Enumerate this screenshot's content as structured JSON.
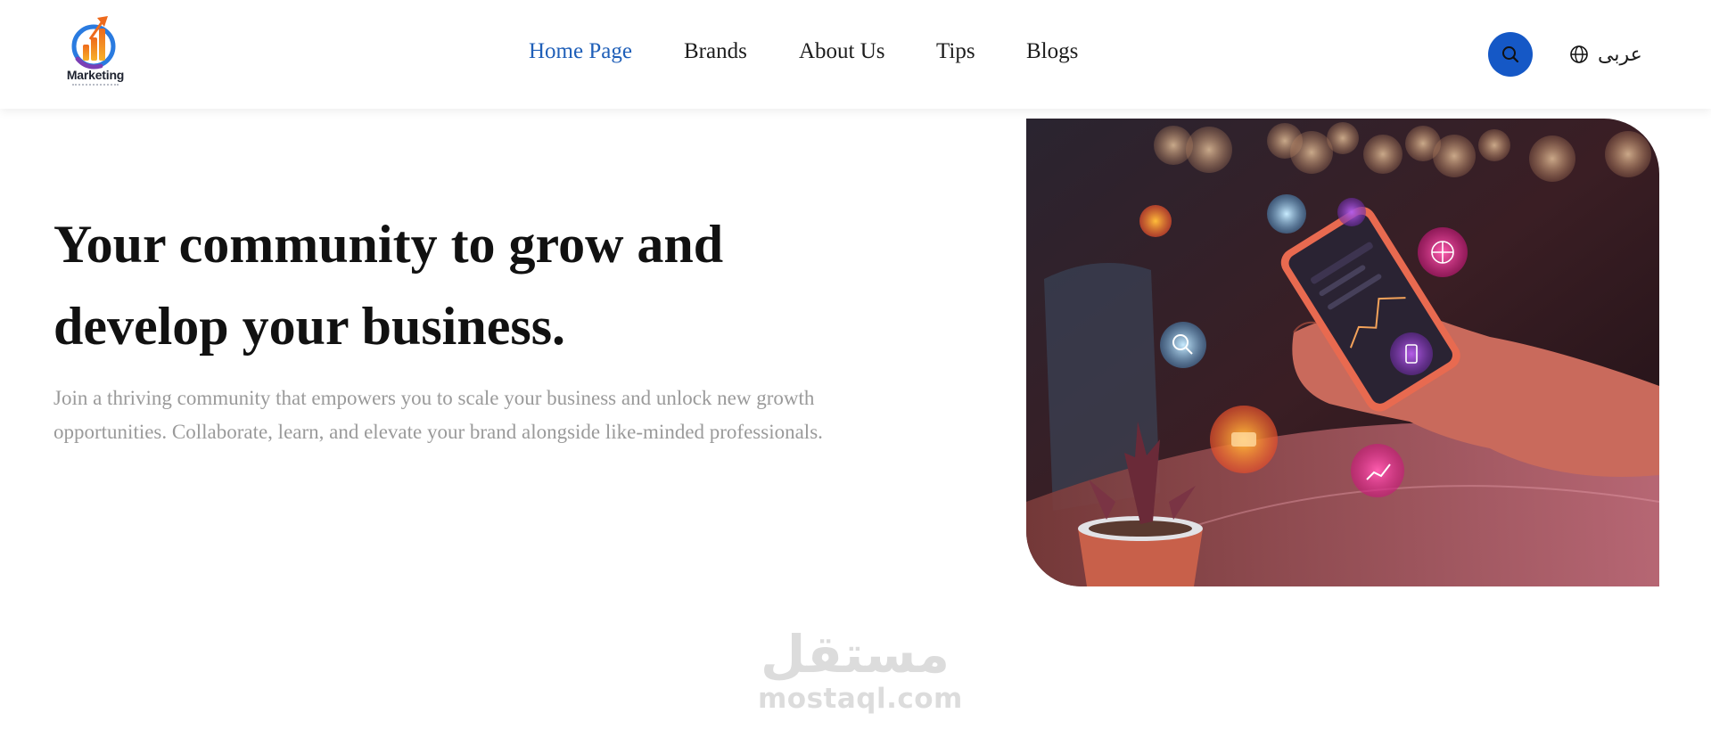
{
  "brand": {
    "logo_text": "Marketing",
    "colors": {
      "orange": "#f08a1c",
      "blue": "#1f5fb8",
      "purple": "#7b3fb5"
    }
  },
  "nav": {
    "items": [
      {
        "label": "Home Page",
        "active": true
      },
      {
        "label": "Brands",
        "active": false
      },
      {
        "label": "About Us",
        "active": false
      },
      {
        "label": "Tips",
        "active": false
      },
      {
        "label": "Blogs",
        "active": false
      }
    ],
    "active_color": "#1f5fb8"
  },
  "header": {
    "search_icon": "search-icon",
    "search_button_color": "#1558c6",
    "language_icon": "globe-icon",
    "language_label": "عربى"
  },
  "hero": {
    "title": "Your community to grow and develop your business.",
    "description": "Join a thriving community that empowers you to scale your business and unlock new growth opportunities. Collaborate, learn, and elevate your brand alongside like-minded professionals.",
    "image": "hand-holding-phone-with-app-icons"
  },
  "watermark": {
    "arabic": "مستقل",
    "latin": "mostaql.com"
  }
}
